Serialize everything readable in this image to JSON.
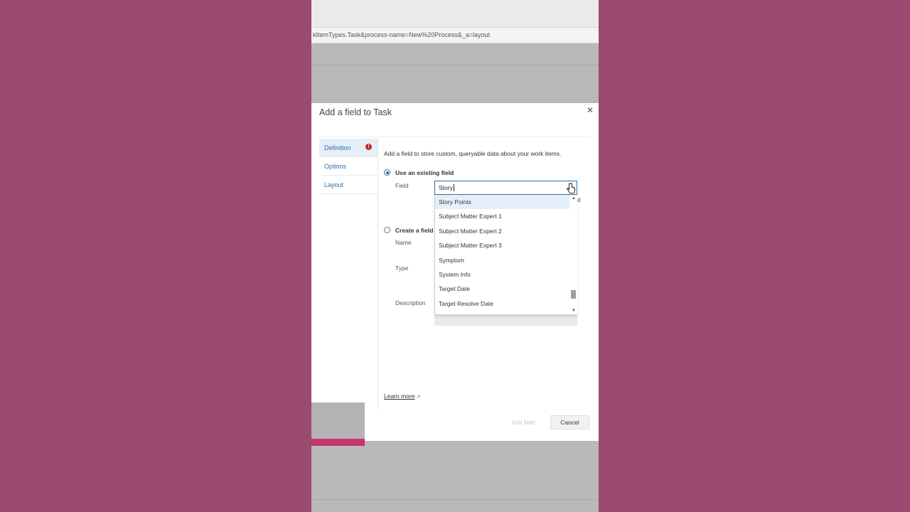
{
  "browser": {
    "url": "kItemTypes.Task&process-name=New%20Process&_a=layout"
  },
  "dialog": {
    "title": "Add a field to Task",
    "close_icon": "close-icon",
    "nav": [
      {
        "label": "Definition",
        "active": true,
        "error": true
      },
      {
        "label": "Options",
        "active": false,
        "error": false
      },
      {
        "label": "Layout",
        "active": false,
        "error": false
      }
    ],
    "intro": "Add a field to store custom, queryable data about your work items.",
    "existing": {
      "label": "Use an existing field",
      "field_label": "Field",
      "field_value": "Story",
      "stray_text": "d"
    },
    "create": {
      "label": "Create a field",
      "name_label": "Name",
      "type_label": "Type",
      "description_label": "Description"
    },
    "dropdown": {
      "items": [
        "Story Points",
        "Subject Matter Expert 1",
        "Subject Matter Expert 2",
        "Subject Matter Expert 3",
        "Symptom",
        "System Info",
        "Target Date",
        "Target Resolve Date"
      ],
      "highlighted_index": 0
    },
    "learn_more": "Learn more",
    "add_button": "Add field",
    "cancel_button": "Cancel"
  },
  "colors": {
    "accent": "#2e6ea8",
    "error": "#c4262e",
    "page_background": "#9b4a70",
    "overlay_accent": "#c5356f"
  }
}
